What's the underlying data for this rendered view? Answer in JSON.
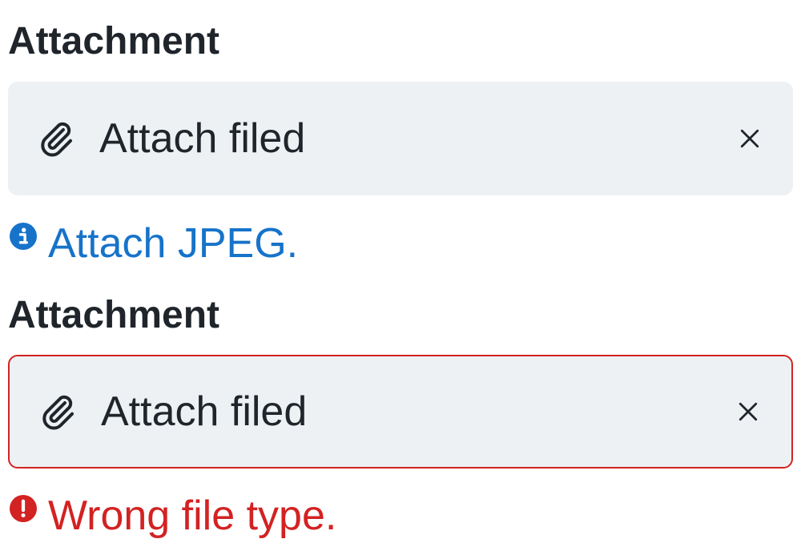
{
  "fields": [
    {
      "label": "Attachment",
      "input_text": "Attach filed",
      "helper_text": "Attach JPEG.",
      "state": "info"
    },
    {
      "label": "Attachment",
      "input_text": "Attach filed",
      "helper_text": "Wrong file type.",
      "state": "error"
    }
  ],
  "colors": {
    "text": "#1f252b",
    "input_bg": "#eef1f4",
    "info": "#1673c9",
    "error": "#d32222"
  },
  "icons": {
    "attach": "paperclip-icon",
    "clear": "close-icon",
    "info": "info-circle-icon",
    "error": "error-circle-icon"
  }
}
